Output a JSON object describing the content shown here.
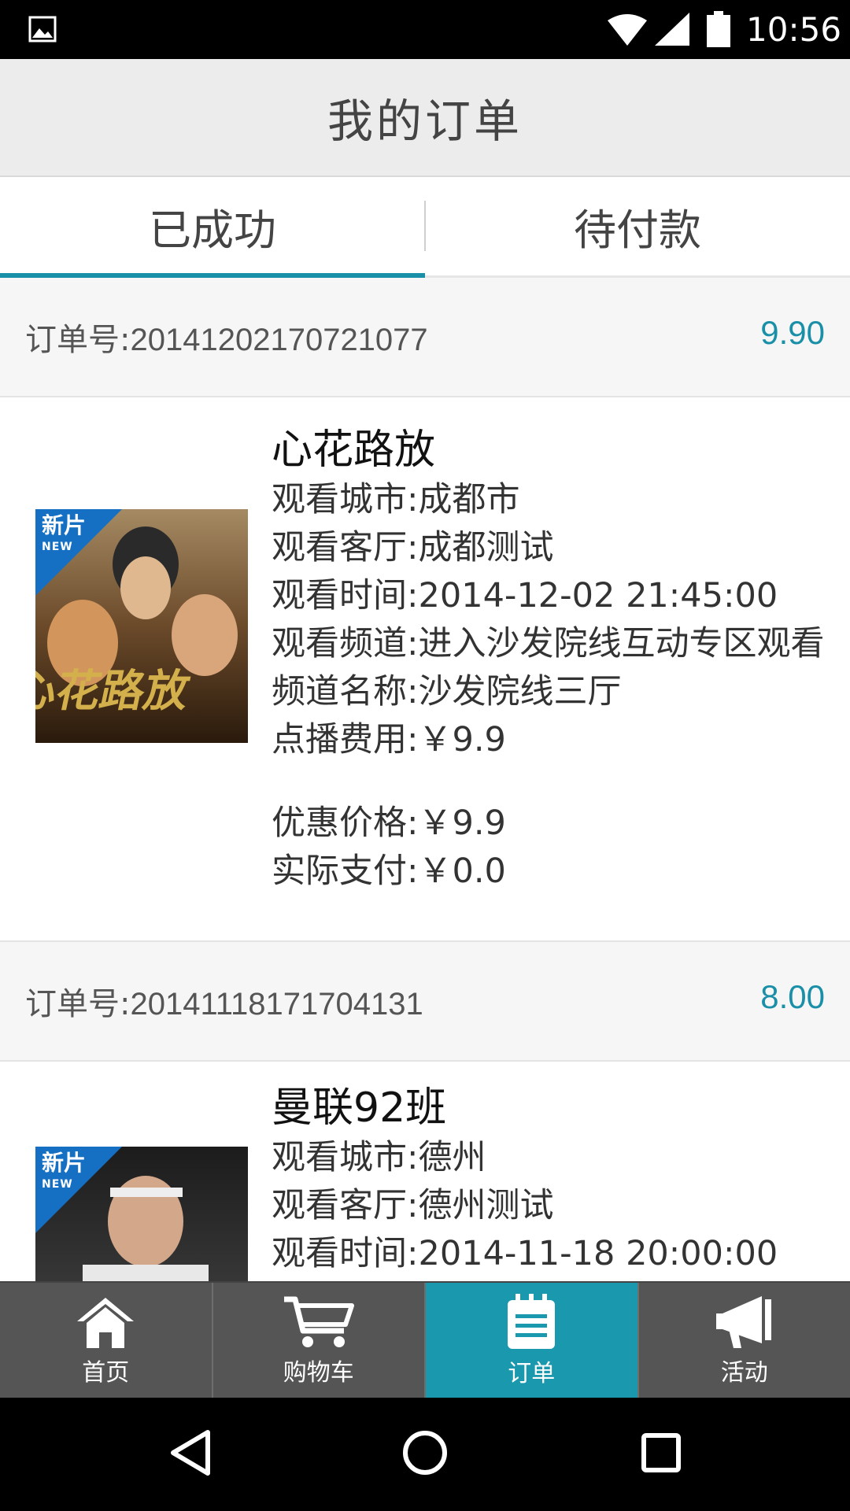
{
  "status_bar": {
    "time": "10:56"
  },
  "header": {
    "title": "我的订单"
  },
  "tabs": [
    {
      "label": "已成功",
      "active": true
    },
    {
      "label": "待付款",
      "active": false
    }
  ],
  "orders": [
    {
      "order_no_label": "订单号:",
      "order_no": "20141202170721077",
      "price": "9.90",
      "poster_badge": "新片",
      "poster_badge_sub": "NEW",
      "movie_title": "心花路放",
      "rows": [
        {
          "label": "观看城市:",
          "value": "成都市"
        },
        {
          "label": "观看客厅:",
          "value": "成都测试"
        },
        {
          "label": "观看时间:",
          "value": "2014-12-02 21:45:00"
        },
        {
          "label": "观看频道:",
          "value": "进入沙发院线互动专区观看"
        },
        {
          "label": "频道名称:",
          "value": "沙发院线三厅"
        },
        {
          "label": "点播费用:",
          "value": "￥9.9"
        }
      ],
      "rows_after_gap": [
        {
          "label": "优惠价格:",
          "value": "￥9.9"
        },
        {
          "label": "实际支付:",
          "value": "￥0.0"
        }
      ]
    },
    {
      "order_no_label": "订单号:",
      "order_no": "20141118171704131",
      "price": "8.00",
      "poster_badge": "新片",
      "poster_badge_sub": "NEW",
      "movie_title": "曼联92班",
      "rows": [
        {
          "label": "观看城市:",
          "value": "德州"
        },
        {
          "label": "观看客厅:",
          "value": "德州测试"
        },
        {
          "label": "观看时间:",
          "value": "2014-11-18 20:00:00"
        }
      ]
    }
  ],
  "bottom_nav": [
    {
      "label": "首页",
      "icon": "home-icon",
      "active": false
    },
    {
      "label": "购物车",
      "icon": "cart-icon",
      "active": false
    },
    {
      "label": "订单",
      "icon": "order-list-icon",
      "active": true
    },
    {
      "label": "活动",
      "icon": "megaphone-icon",
      "active": false
    }
  ],
  "colors": {
    "accent": "#1a8fa8",
    "nav_active": "#1a98ad",
    "nav_bg": "#555555"
  }
}
